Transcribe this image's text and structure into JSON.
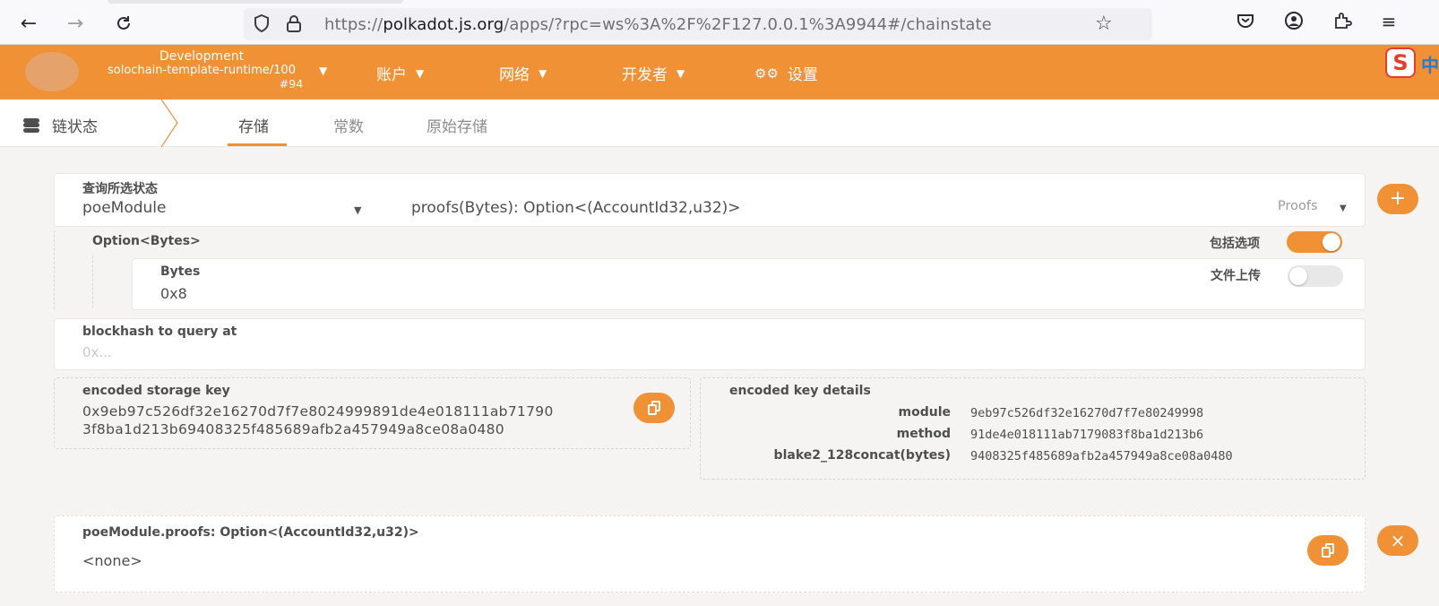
{
  "browser": {
    "url_prefix": "https://",
    "url_domain": "polkadot.js.org",
    "url_path": "/apps/?rpc=ws%3A%2F%2F127.0.0.1%3A9944#/chainstate",
    "icons": [
      "back-icon",
      "forward-icon",
      "reload-icon",
      "shield-icon",
      "lock-icon",
      "star-icon",
      "pocket-icon",
      "account-icon",
      "extensions-icon",
      "menu-icon"
    ]
  },
  "header": {
    "chain_env": "Development",
    "chain_runtime": "solochain-template-runtime/100",
    "chain_block": "#94",
    "menu": [
      {
        "label": "账户"
      },
      {
        "label": "网络"
      },
      {
        "label": "开发者"
      },
      {
        "label": "设置"
      }
    ],
    "accent": "#f19135",
    "ime_badge": "S",
    "ime_lang": "中"
  },
  "subnav": {
    "title": "链状态",
    "tabs": [
      {
        "label": "存储",
        "active": true
      },
      {
        "label": "常数",
        "active": false
      },
      {
        "label": "原始存储",
        "active": false
      }
    ]
  },
  "query": {
    "label": "查询所选状态",
    "module": "poeModule",
    "method": "proofs(Bytes): Option<(AccountId32,u32)>",
    "method_doc": "Proofs",
    "param_label": "Option<Bytes>",
    "include_option_label": "包括选项",
    "include_option_on": true,
    "file_upload_label": "文件上传",
    "file_upload_on": false,
    "bytes_label": "Bytes",
    "bytes_value": "0x8",
    "blockhash_label": "blockhash to query at",
    "blockhash_placeholder": "0x..."
  },
  "encoded": {
    "key_label": "encoded storage key",
    "key_line1": "0x9eb97c526df32e16270d7f7e8024999891de4e018111ab71790",
    "key_line2": "3f8ba1d213b69408325f485689afb2a457949a8ce08a0480",
    "details_label": "encoded key details",
    "details": [
      {
        "name": "module",
        "value": "9eb97c526df32e16270d7f7e80249998"
      },
      {
        "name": "method",
        "value": "91de4e018111ab7179083f8ba1d213b6"
      },
      {
        "name": "blake2_128concat(bytes)",
        "value": "9408325f485689afb2a457949a8ce08a0480"
      }
    ]
  },
  "result": {
    "label": "poeModule.proofs: Option<(AccountId32,u32)>",
    "value": "<none>"
  }
}
